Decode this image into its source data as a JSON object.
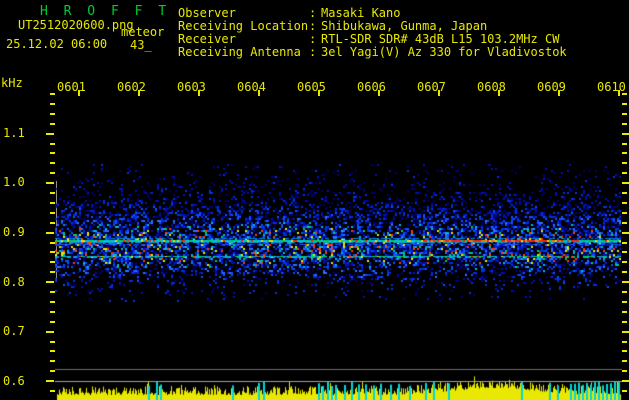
{
  "app": {
    "title": "H R O F F T"
  },
  "header": {
    "filename": "UT2512020600.png",
    "overlay_label": "meteor",
    "datetime": "25.12.02 06:00",
    "count": "43_",
    "separator": ":",
    "fields": [
      {
        "label": "Observer",
        "value": "Masaki Kano"
      },
      {
        "label": "Receiving Location",
        "value": "Shibukawa, Gunma, Japan"
      },
      {
        "label": "Receiver",
        "value": "RTL-SDR SDR# 43dB L15 103.2MHz CW"
      },
      {
        "label": "Receiving Antenna",
        "value": "3el Yagi(V) Az 330 for Vladivostok"
      }
    ]
  },
  "colors": {
    "text_yellow": "#e8e800",
    "title_green": "#00cc33",
    "background": "#000000",
    "gray_reference_line": "#6e6e6e",
    "white_level_line": "#a0a0a0",
    "band_marker_gray": "#909090",
    "noise_yellow": "#e8e800",
    "echo_marker_cyan": "#00d8d8"
  },
  "chart_data": {
    "type": "heatmap",
    "subtype": "radio-meteor-spectrogram",
    "title": "",
    "ylabel": "kHz",
    "y_ticks": [
      "1.1",
      "1.0",
      "0.9",
      "0.8",
      "0.7",
      "0.6"
    ],
    "y_axis_range_khz": [
      0.58,
      1.18
    ],
    "x_ticks": [
      "0601",
      "0602",
      "0603",
      "0604",
      "0605",
      "0606",
      "0607",
      "0608",
      "0609",
      "0610"
    ],
    "x_span_minutes": 10,
    "grid": false,
    "legend": false,
    "noise_band_khz": [
      0.72,
      1.06
    ],
    "reference_band_khz": [
      0.8,
      1.0
    ],
    "carrier_lines": [
      {
        "freq_khz": 0.88,
        "strength": "strong",
        "note": "continuous carrier; red/orange burst roughly 0607-0609, cyan/green/yellow elsewhere"
      },
      {
        "freq_khz": 0.85,
        "strength": "weak",
        "note": "secondary cyan/green line with small red/yellow specks"
      }
    ],
    "bottom_strip": {
      "description": "audio noise level trace with meteor-echo markers",
      "echo_marker_positions_px": [
        148,
        156,
        160,
        232,
        258,
        263,
        318,
        322,
        327,
        331,
        335,
        344,
        351,
        358,
        365,
        373,
        380,
        390,
        398,
        409,
        425,
        433,
        448,
        521,
        549,
        557,
        570,
        574,
        578,
        582,
        586,
        590,
        594,
        598,
        602,
        606,
        610,
        614,
        618
      ]
    },
    "palette_low_to_high": [
      "#000070",
      "#0010b0",
      "#0030e0",
      "#1050ff",
      "#2f70ff",
      "#00b8e0",
      "#00d060",
      "#e8e800",
      "#ff7a00",
      "#ff2800"
    ]
  }
}
